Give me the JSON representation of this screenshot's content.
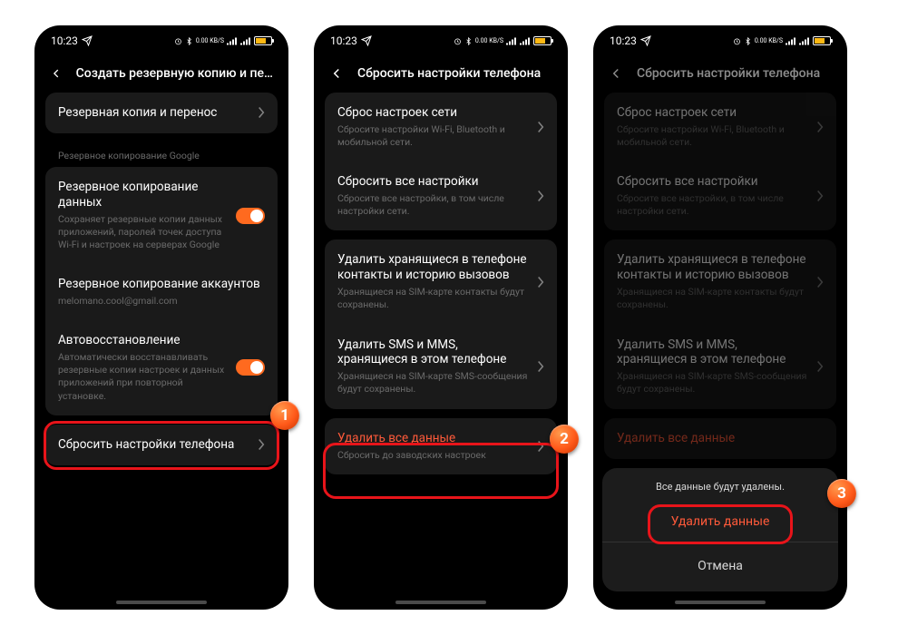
{
  "statusbar": {
    "time": "10:23",
    "speed": "0.00 KB/S"
  },
  "screen1": {
    "header": "Создать резервную копию и перезаг..",
    "rows": {
      "backup_transfer": "Резервная копия и перенос",
      "google_section": "Резервное копирование Google",
      "data_backup_title": "Резервное копирование данных",
      "data_backup_sub": "Сохраняет резервные копии данных приложений, паролей точек доступа Wi-Fi и настроек на серверах Google",
      "account_backup_title": "Резервное копирование аккаунтов",
      "account_backup_sub": "melomano.cool@gmail.com",
      "autorestore_title": "Автовосстановление",
      "autorestore_sub": "Автоматически восстанавливать резервные копии настроек и данных приложений при повторной установке.",
      "reset_phone": "Сбросить настройки телефона"
    },
    "step": "1"
  },
  "screen2": {
    "header": "Сбросить настройки телефона",
    "rows": {
      "net_title": "Сброс настроек сети",
      "net_sub": "Сбросите настройки Wi-Fi, Bluetooth и мобильной сети.",
      "all_title": "Сбросить все настройки",
      "all_sub": "Сбросите все настройки, в том числе настройки сети.",
      "contacts_title": "Удалить хранящиеся в телефоне контакты и историю вызовов",
      "contacts_sub": "Хранящиеся на SIM-карте контакты будут сохранены.",
      "sms_title": "Удалить SMS и MMS, хранящиеся в этом телефоне",
      "sms_sub": "Хранящиеся на SIM-карте SMS-сообщения будут сохранены.",
      "erase_title": "Удалить все данные",
      "erase_sub": "Сбросить до заводских настроек"
    },
    "step": "2"
  },
  "screen3": {
    "header": "Сбросить настройки телефона",
    "erase_title_short": "Удалить все данные",
    "sheet": {
      "msg": "Все данные будут удалены.",
      "confirm": "Удалить данные",
      "cancel": "Отмена"
    },
    "step": "3"
  }
}
